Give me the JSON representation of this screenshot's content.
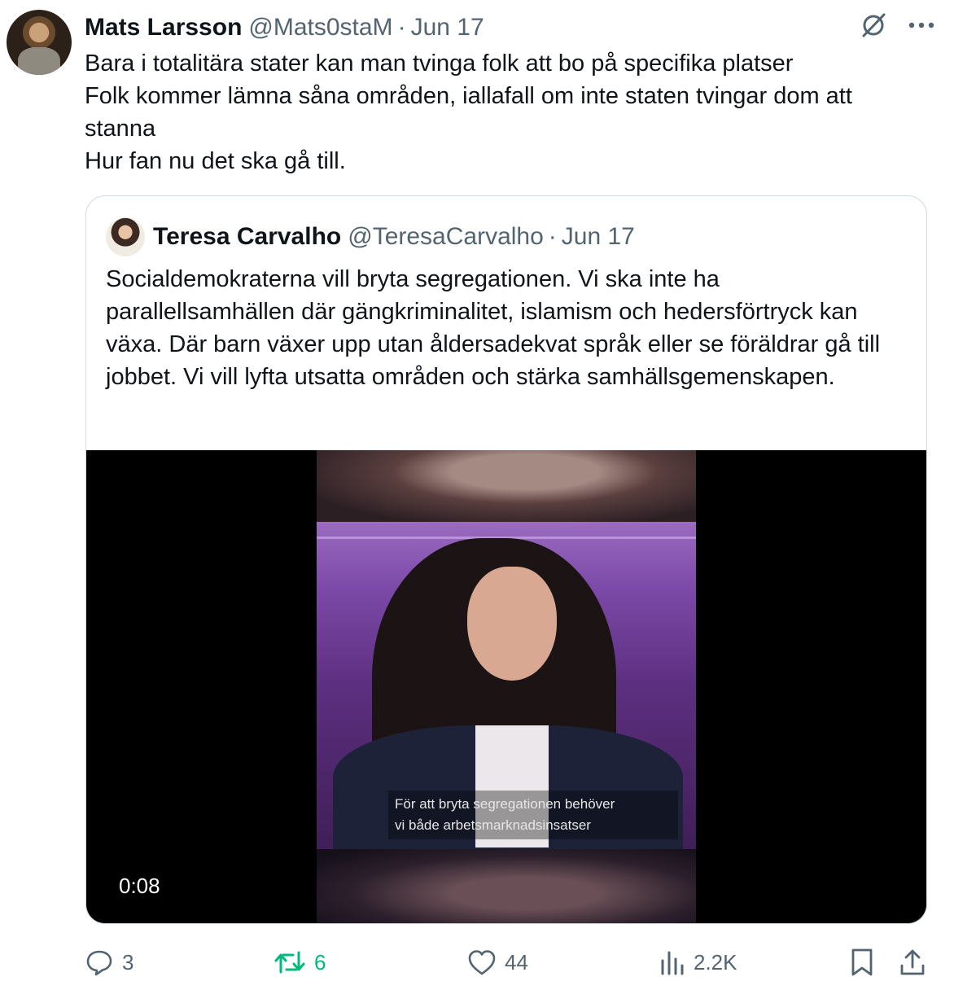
{
  "tweet": {
    "author_name": "Mats Larsson",
    "author_handle": "@Mats0staM",
    "separator": "·",
    "date": "Jun 17",
    "lines": [
      "Bara i totalitära stater kan man tvinga folk att bo på specifika platser",
      "Folk kommer lämna såna områden, iallafall om inte staten tvingar dom att stanna",
      "Hur fan nu det ska gå till."
    ],
    "icons": {
      "grok": "grok-icon",
      "more": "more-icon"
    }
  },
  "quote": {
    "author_name": "Teresa Carvalho",
    "author_handle": "@TeresaCarvalho",
    "separator": "·",
    "date": "Jun 17",
    "text": "Socialdemokraterna vill bryta segregationen. Vi ska inte ha parallellsamhällen där gängkriminalitet, islamism och hedersförtryck kan växa. Där barn växer upp utan åldersadekvat språk eller se föräldrar gå till jobbet. Vi vill lyfta utsatta områden och stärka samhällsgemenskapen.",
    "video": {
      "duration": "0:08",
      "subtitle_line1": "För att bryta segregationen behöver",
      "subtitle_line2": "vi både arbetsmarknadsinsatser"
    }
  },
  "actions": {
    "replies": "3",
    "retweets": "6",
    "likes": "44",
    "views": "2.2K",
    "retweet_color": "#00ba7c",
    "muted_color": "#536471"
  }
}
